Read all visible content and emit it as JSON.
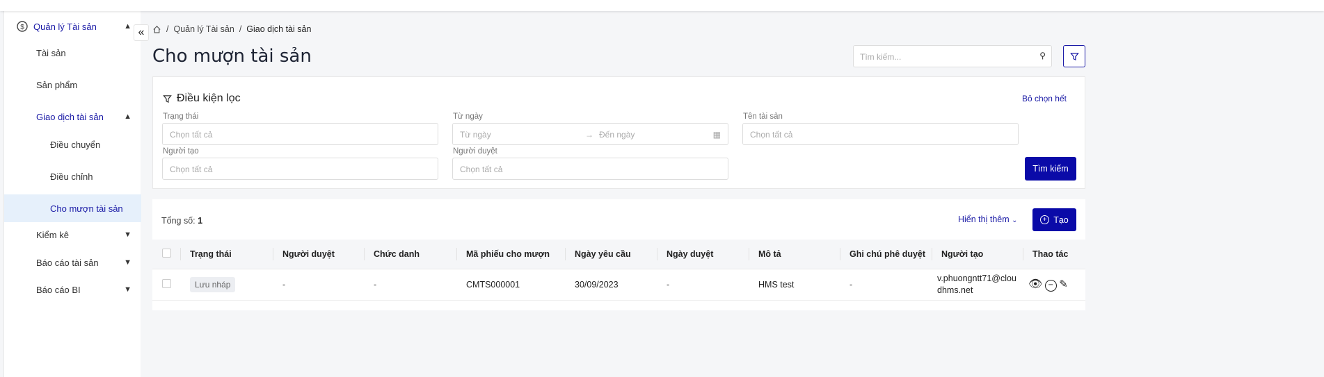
{
  "sidebar": {
    "items": [
      {
        "label": "Quản lý Tài sản"
      },
      {
        "label": "Tài sản"
      },
      {
        "label": "Sản phẩm"
      },
      {
        "label": "Giao dịch tài sản"
      },
      {
        "label": "Điều chuyển"
      },
      {
        "label": "Điều chỉnh"
      },
      {
        "label": "Cho mượn tài sản"
      },
      {
        "label": "Kiểm kê"
      },
      {
        "label": "Báo cáo tài sản"
      },
      {
        "label": "Báo cáo BI"
      }
    ]
  },
  "breadcrumb": [
    "Quản lý Tài sản",
    "Giao dịch tài sản"
  ],
  "page_title": "Cho mượn tài sản",
  "search": {
    "placeholder": "Tìm kiếm..."
  },
  "filter": {
    "title": "Điều kiện lọc",
    "clear_all": "Bỏ chọn hết",
    "status_label": "Trạng thái",
    "status_placeholder": "Chọn tất cả",
    "from_label": "Từ ngày",
    "from_placeholder": "Từ ngày",
    "to_placeholder": "Đến ngày",
    "asset_label": "Tên tài sản",
    "asset_placeholder": "Chọn tất cả",
    "creator_label": "Người tạo",
    "creator_placeholder": "Chọn tất cả",
    "approver_label": "Người duyệt",
    "approver_placeholder": "Chọn tất cả",
    "search_button": "Tìm kiếm"
  },
  "list": {
    "total_label": "Tổng số:",
    "total": "1",
    "show_more": "Hiển thị thêm",
    "create": "Tạo",
    "columns": [
      "Trạng thái",
      "Người duyệt",
      "Chức danh",
      "Mã phiếu cho mượn",
      "Ngày yêu cầu",
      "Ngày duyệt",
      "Mô tả",
      "Ghi chú phê duyệt",
      "Người tạo",
      "Thao tác"
    ],
    "rows": [
      {
        "status": "Lưu nháp",
        "approver": "-",
        "title": "-",
        "code": "CMTS000001",
        "request_date": "30/09/2023",
        "approve_date": "-",
        "description": "HMS test",
        "note": "-",
        "creator": "v.phuongntt71@cloudhms.net"
      }
    ]
  }
}
